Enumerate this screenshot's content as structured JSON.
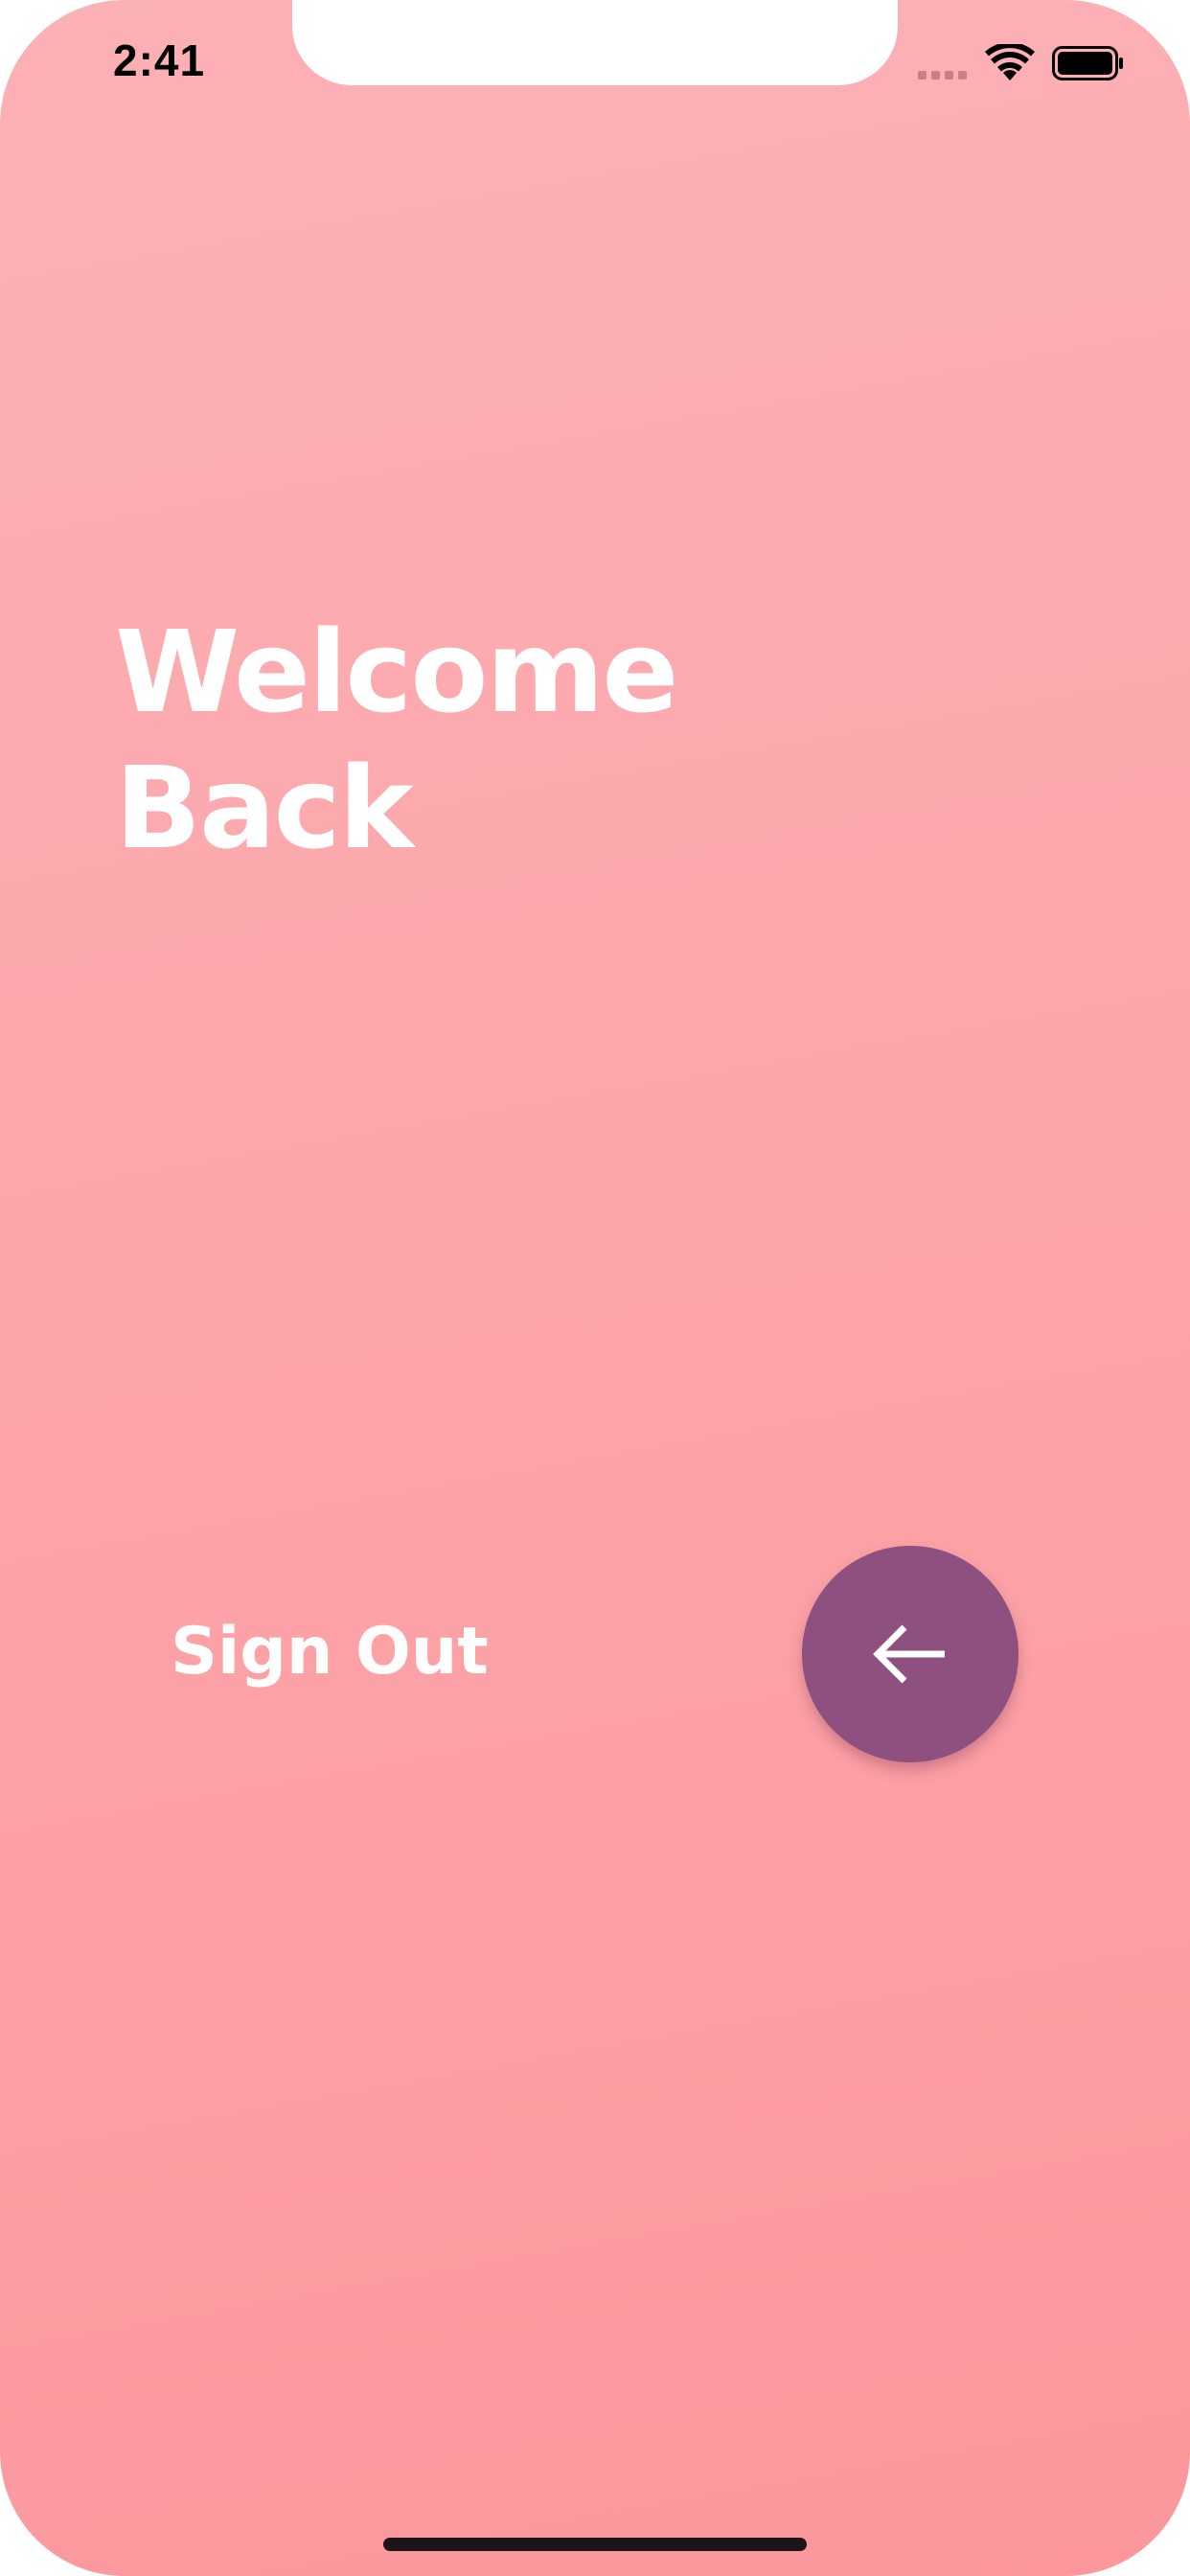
{
  "status_bar": {
    "time": "2:41",
    "icons": [
      "signal-dots-icon",
      "wifi-icon",
      "battery-icon"
    ]
  },
  "screen": {
    "title": "Welcome\nBack",
    "sign_out_label": "Sign Out",
    "action_button_icon": "arrow-left-icon"
  },
  "colors": {
    "background_top": "#fcb1b6",
    "background_bottom": "#fb979d",
    "fab_background": "#8e507e",
    "text": "#ffffff"
  }
}
